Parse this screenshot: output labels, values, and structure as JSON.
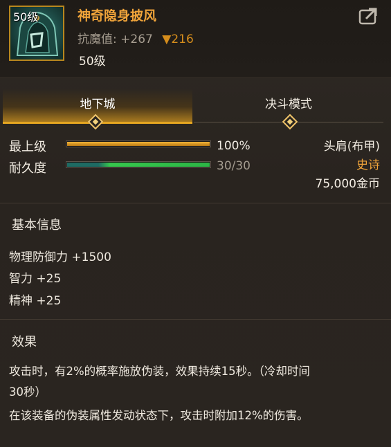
{
  "item": {
    "icon_level": "50级",
    "name": "神奇隐身披风",
    "stat_label": "抗魔值:",
    "stat_value": "+267",
    "stat_diff": "216",
    "level": "50级"
  },
  "icons": {
    "share": "share-export-icon",
    "item": "cloak-shoulder-icon"
  },
  "tabs": [
    {
      "label": "地下城"
    },
    {
      "label": "决斗模式"
    }
  ],
  "upgrade": {
    "label": "最上级",
    "value": "100%",
    "fraction": 1.0
  },
  "durability": {
    "label": "耐久度",
    "value": "30/30",
    "fraction": 1.0
  },
  "info": {
    "slot": "头肩(布甲)",
    "rarity": "史诗",
    "price": "75,000金币"
  },
  "basic": {
    "title": "基本信息",
    "stats": [
      "物理防御力 +1500",
      "智力 +25",
      "精神 +25"
    ]
  },
  "effect": {
    "title": "效果",
    "lines": [
      "攻击时，有2%的概率施放伪装，效果持续15秒。（冷却时间",
      "30秒）",
      "在该装备的伪装属性发动状态下，攻击时附加12%的伤害。"
    ]
  },
  "colors": {
    "accent": "#e3a521",
    "name": "#f0a43a",
    "rarity": "#f0a43a",
    "bar_upgrade": "#d6901c",
    "bar_durability": "#2fb84a"
  }
}
